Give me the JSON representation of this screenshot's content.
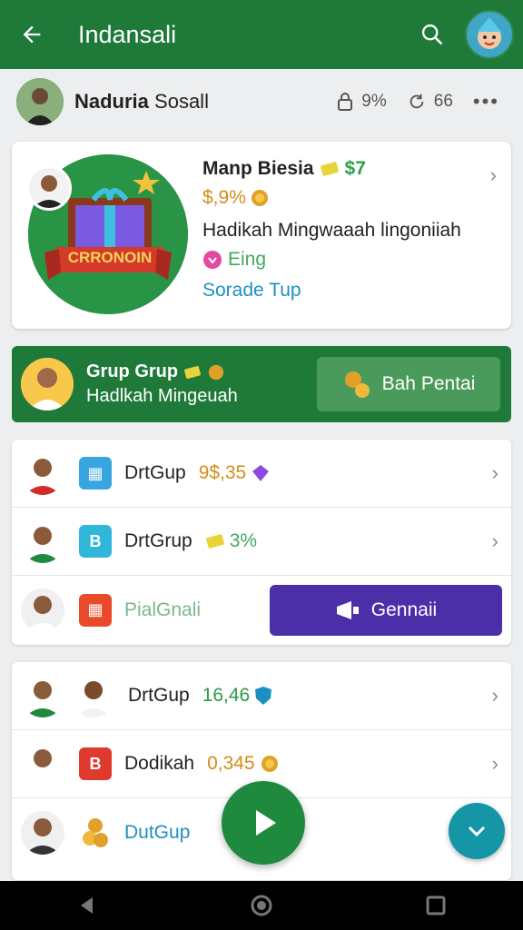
{
  "appbar": {
    "title": "Indansali",
    "back_icon": "arrow-left-icon",
    "search_icon": "search-icon"
  },
  "user": {
    "name_bold": "Naduria",
    "name_rest": " Sosall",
    "stat1": "9%",
    "stat2": "66",
    "more": "•••"
  },
  "featured": {
    "title": "Manp Biesia",
    "title_suffix": "$7",
    "price": "$,9%",
    "description": "Hadikah Mingwaaah lingoniiah",
    "tag": "Eing",
    "link": "Sorade Tup",
    "banner_text": "CRRONOIN"
  },
  "group": {
    "title": "Grup Grup",
    "subtitle": "Hadlkah Mingeuah",
    "button": "Bah Pentai"
  },
  "list1": [
    {
      "name": "DrtGup",
      "value": "9$,35",
      "value_color": "#d58c16",
      "icon_color": "#37a6e0",
      "icon_label": ""
    },
    {
      "name": "DrtGrup",
      "value": "3%",
      "value_color": "#43a85c",
      "icon_color": "#2fb6d8",
      "icon_label": "B"
    },
    {
      "name": "PialGnali",
      "button": "Gennaii",
      "icon_color": "#e84a2a",
      "icon_label": ""
    }
  ],
  "list2": [
    {
      "name": "DrtGup",
      "value": "16,46",
      "value_color": "#2e9a48"
    },
    {
      "name": "Dodikah",
      "value": "0,345",
      "value_color": "#d58c16",
      "icon_color": "#e03a2e",
      "icon_label": "B"
    },
    {
      "name": "DutGup",
      "value": "",
      "value_color": "#1e90c0"
    }
  ],
  "colors": {
    "primary": "#1f7a3a",
    "accent": "#4a2fa8",
    "gold": "#d58c16"
  }
}
